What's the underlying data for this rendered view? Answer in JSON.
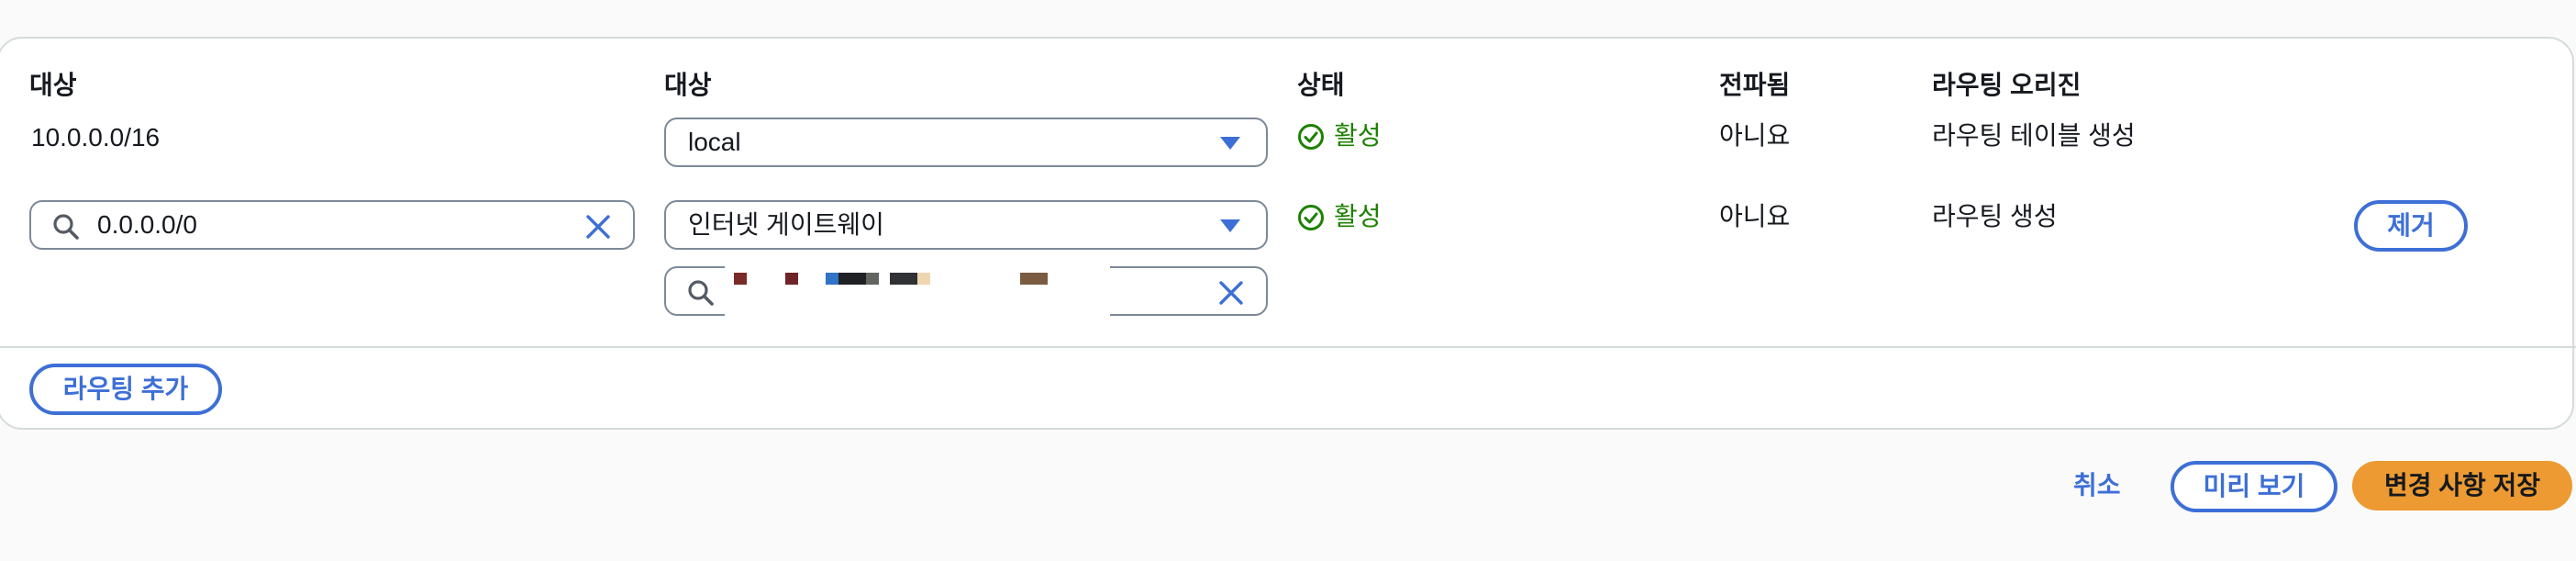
{
  "table": {
    "headers": {
      "destination": "대상",
      "target": "대상",
      "status": "상태",
      "propagated": "전파됨",
      "route_origin": "라우팅 오리진"
    },
    "rows": [
      {
        "destination": "10.0.0.0/16",
        "target": "local",
        "status": "활성",
        "propagated": "아니요",
        "route_origin": "라우팅 테이블 생성"
      },
      {
        "destination": "0.0.0.0/0",
        "target": "인터넷 게이트웨이",
        "target_filter": "",
        "status": "활성",
        "propagated": "아니요",
        "route_origin": "라우팅 생성",
        "remove_label": "제거"
      }
    ]
  },
  "add_route_label": "라우팅 추가",
  "footer": {
    "cancel_label": "취소",
    "preview_label": "미리 보기",
    "save_label": "변경 사항 저장"
  },
  "colors": {
    "accent": "#3d6fd6",
    "status_active": "#1d8102",
    "primary_button": "#ec9a31"
  },
  "icons": {
    "search": "search-icon",
    "clear": "close-icon",
    "dropdown": "caret-down-icon",
    "status": "check-circle-icon"
  }
}
